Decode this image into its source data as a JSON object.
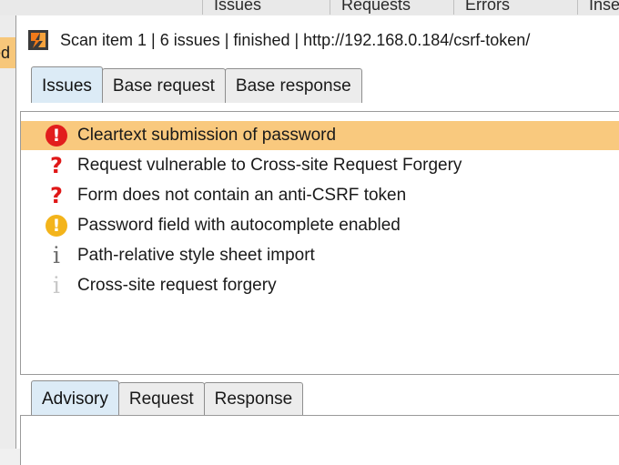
{
  "top_columns": [
    "Issues",
    "Requests",
    "Errors",
    "Inse"
  ],
  "left_cell_text": "ed",
  "title": "Scan item 1 | 6 issues | finished | http://192.168.0.184/csrf-token/",
  "tabs": [
    {
      "label": "Issues",
      "active": true
    },
    {
      "label": "Base request",
      "active": false
    },
    {
      "label": "Base response",
      "active": false
    }
  ],
  "issues": [
    {
      "label": "Cleartext submission of password",
      "severity": "high",
      "selected": true
    },
    {
      "label": "Request vulnerable to Cross-site Request Forgery",
      "severity": "tentative"
    },
    {
      "label": "Form does not contain an anti-CSRF token",
      "severity": "tentative"
    },
    {
      "label": "Password field with autocomplete enabled",
      "severity": "medium"
    },
    {
      "label": "Path-relative style sheet import",
      "severity": "info"
    },
    {
      "label": "Cross-site request forgery",
      "severity": "info-light"
    }
  ],
  "bottom_tabs": [
    {
      "label": "Advisory",
      "active": true
    },
    {
      "label": "Request",
      "active": false
    },
    {
      "label": "Response",
      "active": false
    }
  ],
  "colors": {
    "selected_row": "#f9c97e",
    "active_tab": "#dcebf6",
    "high": "#e21d1d",
    "medium": "#f3b41b",
    "burp_orange": "#f07a1a"
  }
}
